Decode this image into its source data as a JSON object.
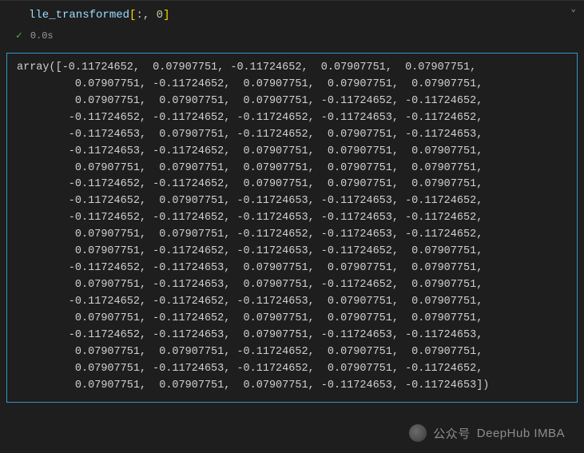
{
  "cell": {
    "code_variable": "lle_transformed",
    "code_index_all": ":",
    "code_index_col": "0",
    "exec_time": "0.0s"
  },
  "output": {
    "prefix": "array([",
    "suffix": "])",
    "rows": [
      [
        "-0.11724652",
        " 0.07907751",
        "-0.11724652",
        " 0.07907751",
        " 0.07907751"
      ],
      [
        " 0.07907751",
        "-0.11724652",
        " 0.07907751",
        " 0.07907751",
        " 0.07907751"
      ],
      [
        " 0.07907751",
        " 0.07907751",
        " 0.07907751",
        "-0.11724652",
        "-0.11724652"
      ],
      [
        "-0.11724652",
        "-0.11724652",
        "-0.11724652",
        "-0.11724653",
        "-0.11724652"
      ],
      [
        "-0.11724653",
        " 0.07907751",
        "-0.11724652",
        " 0.07907751",
        "-0.11724653"
      ],
      [
        "-0.11724653",
        "-0.11724652",
        " 0.07907751",
        " 0.07907751",
        " 0.07907751"
      ],
      [
        " 0.07907751",
        " 0.07907751",
        " 0.07907751",
        " 0.07907751",
        " 0.07907751"
      ],
      [
        "-0.11724652",
        "-0.11724652",
        " 0.07907751",
        " 0.07907751",
        " 0.07907751"
      ],
      [
        "-0.11724652",
        " 0.07907751",
        "-0.11724653",
        "-0.11724653",
        "-0.11724652"
      ],
      [
        "-0.11724652",
        "-0.11724652",
        "-0.11724653",
        "-0.11724653",
        "-0.11724652"
      ],
      [
        " 0.07907751",
        " 0.07907751",
        "-0.11724652",
        "-0.11724653",
        "-0.11724652"
      ],
      [
        " 0.07907751",
        "-0.11724652",
        "-0.11724653",
        "-0.11724652",
        " 0.07907751"
      ],
      [
        "-0.11724652",
        "-0.11724653",
        " 0.07907751",
        " 0.07907751",
        " 0.07907751"
      ],
      [
        " 0.07907751",
        "-0.11724653",
        " 0.07907751",
        "-0.11724652",
        " 0.07907751"
      ],
      [
        "-0.11724652",
        "-0.11724652",
        "-0.11724653",
        " 0.07907751",
        " 0.07907751"
      ],
      [
        " 0.07907751",
        "-0.11724652",
        " 0.07907751",
        " 0.07907751",
        " 0.07907751"
      ],
      [
        "-0.11724652",
        "-0.11724653",
        " 0.07907751",
        "-0.11724653",
        "-0.11724653"
      ],
      [
        " 0.07907751",
        " 0.07907751",
        "-0.11724652",
        " 0.07907751",
        " 0.07907751"
      ],
      [
        " 0.07907751",
        "-0.11724653",
        "-0.11724652",
        " 0.07907751",
        "-0.11724652"
      ],
      [
        " 0.07907751",
        " 0.07907751",
        " 0.07907751",
        "-0.11724653",
        "-0.11724653"
      ]
    ]
  },
  "watermark": {
    "label_prefix": "公众号",
    "label_name": "DeepHub IMBA"
  }
}
